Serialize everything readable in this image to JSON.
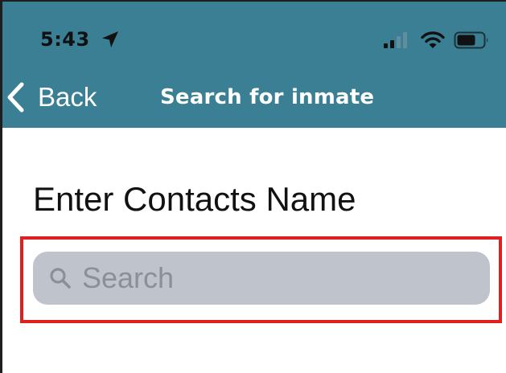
{
  "status_bar": {
    "time": "5:43",
    "location_icon": "location-arrow-icon",
    "signal_icon": "cellular-signal-icon",
    "wifi_icon": "wifi-icon",
    "battery_icon": "battery-icon"
  },
  "nav_bar": {
    "back_label": "Back",
    "back_icon": "chevron-left-icon",
    "title": "Search for inmate",
    "background_color": "#3a7f93"
  },
  "form": {
    "label": "Enter Contacts Name",
    "search_placeholder": "Search",
    "search_value": "",
    "search_icon": "magnifier-icon",
    "highlight_color": "#e0201f"
  }
}
